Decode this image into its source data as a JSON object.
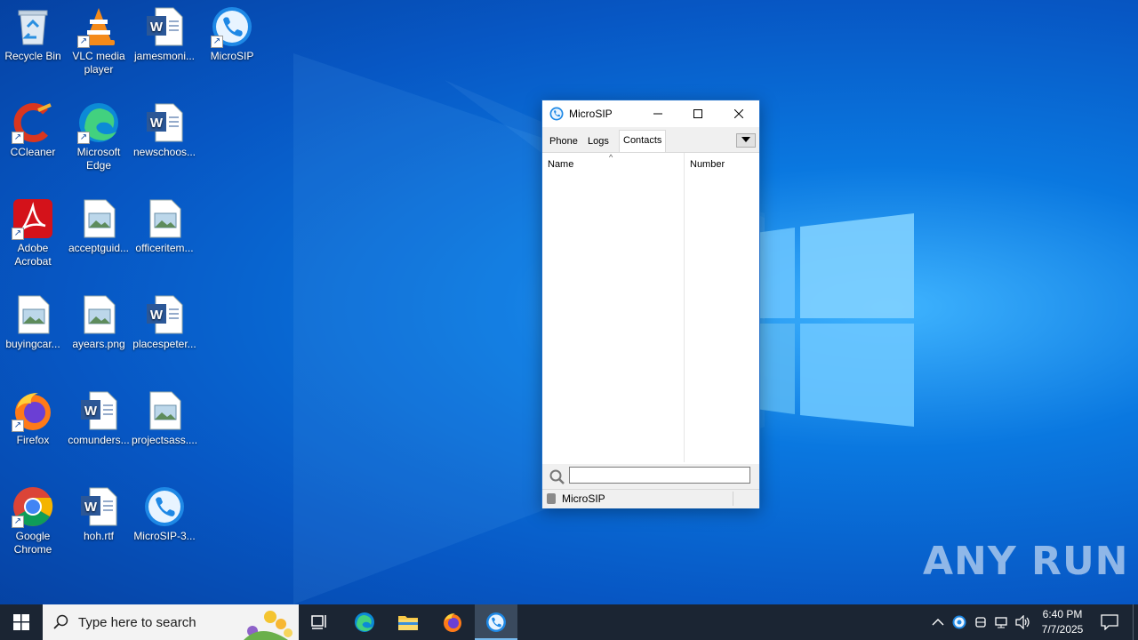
{
  "desktop": {
    "icons": [
      {
        "label": "Recycle Bin",
        "icon": "recycle-bin-icon"
      },
      {
        "label": "VLC media player",
        "icon": "vlc-icon"
      },
      {
        "label": "jamesmoni...",
        "icon": "word-doc-icon"
      },
      {
        "label": "MicroSIP",
        "icon": "microsip-icon"
      },
      {
        "label": "CCleaner",
        "icon": "ccleaner-icon"
      },
      {
        "label": "Microsoft Edge",
        "icon": "edge-icon"
      },
      {
        "label": "newschoos...",
        "icon": "word-doc-icon"
      },
      {
        "label": "Adobe Acrobat",
        "icon": "acrobat-icon"
      },
      {
        "label": "acceptguid...",
        "icon": "image-file-icon"
      },
      {
        "label": "officeritem...",
        "icon": "image-file-icon"
      },
      {
        "label": "buyingcar...",
        "icon": "image-file-icon"
      },
      {
        "label": "ayears.png",
        "icon": "image-file-icon"
      },
      {
        "label": "placespeter...",
        "icon": "word-doc-icon"
      },
      {
        "label": "Firefox",
        "icon": "firefox-icon"
      },
      {
        "label": "comunders...",
        "icon": "word-doc-icon"
      },
      {
        "label": "projectsass....",
        "icon": "image-file-icon"
      },
      {
        "label": "Google Chrome",
        "icon": "chrome-icon"
      },
      {
        "label": "hoh.rtf",
        "icon": "word-doc-icon"
      },
      {
        "label": "MicroSIP-3...",
        "icon": "microsip-icon"
      }
    ]
  },
  "window": {
    "title": "MicroSIP",
    "tabs": [
      {
        "label": "Phone"
      },
      {
        "label": "Logs"
      },
      {
        "label": "Contacts",
        "selected": true
      }
    ],
    "columns": {
      "name": "Name",
      "number": "Number"
    },
    "search_value": "",
    "status": "MicroSIP"
  },
  "taskbar": {
    "search_placeholder": "Type here to search",
    "time": "6:40 PM",
    "date": "7/7/2025"
  },
  "watermark": "ANY RUN",
  "colors": {
    "accent": "#0078d7",
    "taskbar": "#1b2533",
    "microsip": "#1e88e5"
  }
}
